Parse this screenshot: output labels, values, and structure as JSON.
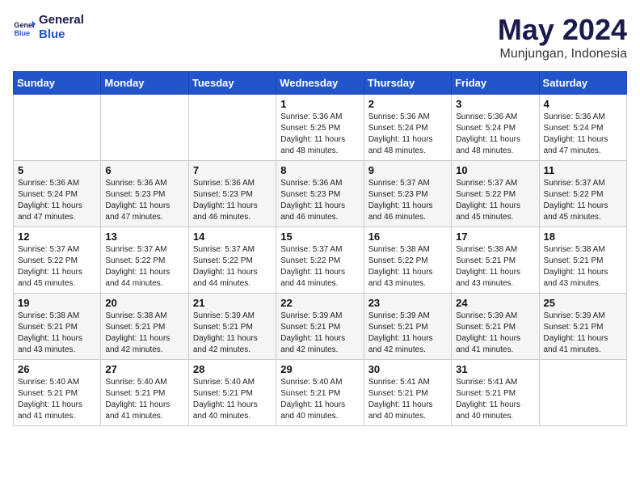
{
  "logo": {
    "line1": "General",
    "line2": "Blue"
  },
  "title": "May 2024",
  "subtitle": "Munjungan, Indonesia",
  "weekdays": [
    "Sunday",
    "Monday",
    "Tuesday",
    "Wednesday",
    "Thursday",
    "Friday",
    "Saturday"
  ],
  "weeks": [
    [
      {
        "day": "",
        "info": ""
      },
      {
        "day": "",
        "info": ""
      },
      {
        "day": "",
        "info": ""
      },
      {
        "day": "1",
        "info": "Sunrise: 5:36 AM\nSunset: 5:25 PM\nDaylight: 11 hours\nand 48 minutes."
      },
      {
        "day": "2",
        "info": "Sunrise: 5:36 AM\nSunset: 5:24 PM\nDaylight: 11 hours\nand 48 minutes."
      },
      {
        "day": "3",
        "info": "Sunrise: 5:36 AM\nSunset: 5:24 PM\nDaylight: 11 hours\nand 48 minutes."
      },
      {
        "day": "4",
        "info": "Sunrise: 5:36 AM\nSunset: 5:24 PM\nDaylight: 11 hours\nand 47 minutes."
      }
    ],
    [
      {
        "day": "5",
        "info": "Sunrise: 5:36 AM\nSunset: 5:24 PM\nDaylight: 11 hours\nand 47 minutes."
      },
      {
        "day": "6",
        "info": "Sunrise: 5:36 AM\nSunset: 5:23 PM\nDaylight: 11 hours\nand 47 minutes."
      },
      {
        "day": "7",
        "info": "Sunrise: 5:36 AM\nSunset: 5:23 PM\nDaylight: 11 hours\nand 46 minutes."
      },
      {
        "day": "8",
        "info": "Sunrise: 5:36 AM\nSunset: 5:23 PM\nDaylight: 11 hours\nand 46 minutes."
      },
      {
        "day": "9",
        "info": "Sunrise: 5:37 AM\nSunset: 5:23 PM\nDaylight: 11 hours\nand 46 minutes."
      },
      {
        "day": "10",
        "info": "Sunrise: 5:37 AM\nSunset: 5:22 PM\nDaylight: 11 hours\nand 45 minutes."
      },
      {
        "day": "11",
        "info": "Sunrise: 5:37 AM\nSunset: 5:22 PM\nDaylight: 11 hours\nand 45 minutes."
      }
    ],
    [
      {
        "day": "12",
        "info": "Sunrise: 5:37 AM\nSunset: 5:22 PM\nDaylight: 11 hours\nand 45 minutes."
      },
      {
        "day": "13",
        "info": "Sunrise: 5:37 AM\nSunset: 5:22 PM\nDaylight: 11 hours\nand 44 minutes."
      },
      {
        "day": "14",
        "info": "Sunrise: 5:37 AM\nSunset: 5:22 PM\nDaylight: 11 hours\nand 44 minutes."
      },
      {
        "day": "15",
        "info": "Sunrise: 5:37 AM\nSunset: 5:22 PM\nDaylight: 11 hours\nand 44 minutes."
      },
      {
        "day": "16",
        "info": "Sunrise: 5:38 AM\nSunset: 5:22 PM\nDaylight: 11 hours\nand 43 minutes."
      },
      {
        "day": "17",
        "info": "Sunrise: 5:38 AM\nSunset: 5:21 PM\nDaylight: 11 hours\nand 43 minutes."
      },
      {
        "day": "18",
        "info": "Sunrise: 5:38 AM\nSunset: 5:21 PM\nDaylight: 11 hours\nand 43 minutes."
      }
    ],
    [
      {
        "day": "19",
        "info": "Sunrise: 5:38 AM\nSunset: 5:21 PM\nDaylight: 11 hours\nand 43 minutes."
      },
      {
        "day": "20",
        "info": "Sunrise: 5:38 AM\nSunset: 5:21 PM\nDaylight: 11 hours\nand 42 minutes."
      },
      {
        "day": "21",
        "info": "Sunrise: 5:39 AM\nSunset: 5:21 PM\nDaylight: 11 hours\nand 42 minutes."
      },
      {
        "day": "22",
        "info": "Sunrise: 5:39 AM\nSunset: 5:21 PM\nDaylight: 11 hours\nand 42 minutes."
      },
      {
        "day": "23",
        "info": "Sunrise: 5:39 AM\nSunset: 5:21 PM\nDaylight: 11 hours\nand 42 minutes."
      },
      {
        "day": "24",
        "info": "Sunrise: 5:39 AM\nSunset: 5:21 PM\nDaylight: 11 hours\nand 41 minutes."
      },
      {
        "day": "25",
        "info": "Sunrise: 5:39 AM\nSunset: 5:21 PM\nDaylight: 11 hours\nand 41 minutes."
      }
    ],
    [
      {
        "day": "26",
        "info": "Sunrise: 5:40 AM\nSunset: 5:21 PM\nDaylight: 11 hours\nand 41 minutes."
      },
      {
        "day": "27",
        "info": "Sunrise: 5:40 AM\nSunset: 5:21 PM\nDaylight: 11 hours\nand 41 minutes."
      },
      {
        "day": "28",
        "info": "Sunrise: 5:40 AM\nSunset: 5:21 PM\nDaylight: 11 hours\nand 40 minutes."
      },
      {
        "day": "29",
        "info": "Sunrise: 5:40 AM\nSunset: 5:21 PM\nDaylight: 11 hours\nand 40 minutes."
      },
      {
        "day": "30",
        "info": "Sunrise: 5:41 AM\nSunset: 5:21 PM\nDaylight: 11 hours\nand 40 minutes."
      },
      {
        "day": "31",
        "info": "Sunrise: 5:41 AM\nSunset: 5:21 PM\nDaylight: 11 hours\nand 40 minutes."
      },
      {
        "day": "",
        "info": ""
      }
    ]
  ]
}
